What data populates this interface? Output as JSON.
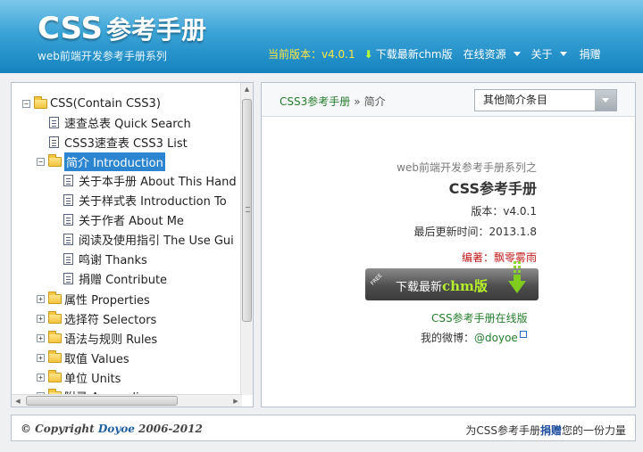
{
  "header": {
    "logo_latin": "CSS",
    "logo_cn": "参考手册",
    "subtitle": "web前端开发参考手册系列",
    "version_text": "当前版本：v4.0.1",
    "download_text": "下载最新chm版",
    "online_resources": "在线资源",
    "about": "关于",
    "donate": "捐赠"
  },
  "tree": {
    "root": "CSS(Contain CSS3)",
    "quick_search": "速查总表 Quick Search",
    "css3_list": "CSS3速查表 CSS3 List",
    "intro": "简介 Introduction",
    "intro_children": [
      "关于本手册 About This Hand",
      "关于样式表 Introduction To",
      "关于作者 About Me",
      "阅读及使用指引 The Use Gui",
      "鸣谢 Thanks",
      "捐赠 Contribute"
    ],
    "folders": [
      "属性 Properties",
      "选择符 Selectors",
      "语法与规则 Rules",
      "取值 Values",
      "单位 Units",
      "附录 Appendix"
    ]
  },
  "content": {
    "breadcrumb_home": "CSS3参考手册",
    "breadcrumb_sep": "»",
    "breadcrumb_current": "简介",
    "select_value": "其他简介条目",
    "series": "web前端开发参考手册系列之",
    "manual_name": "CSS参考手册",
    "version": "版本：v4.0.1",
    "updated": "最后更新时间：2013.1.8",
    "editor": "编著：飘零雾雨",
    "free_tag": "FREE",
    "download_prefix": "下载最新",
    "download_chm": "chm版",
    "online_link": "CSS参考手册在线版",
    "weibo_label": "我的微博：",
    "weibo_handle": "@doyoe"
  },
  "footer": {
    "copyright_prefix": "© Copyright ",
    "copyright_brand": "Doyoe",
    "copyright_years": " 2006-2012",
    "donate_prefix": "为CSS参考手册",
    "donate_link": "捐赠",
    "donate_suffix": "您的一份力量"
  },
  "colors": {
    "header_top": "#7dc7ea",
    "header_bottom": "#1583bf",
    "version_yellow": "#ffe642",
    "link_green": "#247d2c",
    "editor_red": "#c21d1d",
    "selection_blue": "#2c85d0"
  }
}
